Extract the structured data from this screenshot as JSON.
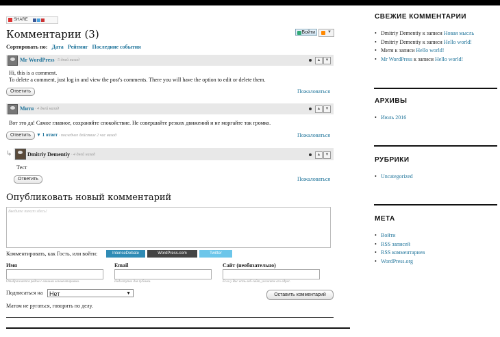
{
  "share_bar": {
    "label": "SHARE"
  },
  "comments": {
    "title": "Комментарии (3)",
    "login_button": "Войти",
    "sort": {
      "label": "Сортировать по:",
      "options": [
        "Дата",
        "Рейтинг",
        "Последние события"
      ]
    },
    "items": [
      {
        "author": "Mr WordPress",
        "meta": "· 5 дней назад",
        "text": [
          "Hi, this is a comment.",
          "To delete a comment, just log in and view the post's comments. There you will have the option to edit or delete them."
        ],
        "reply": "Ответить",
        "report": "Пожаловаться"
      },
      {
        "author": "Митя",
        "meta": "· 4 дней назад",
        "text": [
          "Вот это да! Самое главное, сохраняйте спокойствие. Не совершайте резких движений и не моргайте так громко."
        ],
        "reply": "Ответить",
        "thread_count": "▼ 1 ответ",
        "thread_last": "· последнее действие 2 час назад",
        "report": "Пожаловаться"
      },
      {
        "author": "Dmitriy Dementiy",
        "meta": "· 4 дней назад",
        "text": [
          "Тест"
        ],
        "reply": "Ответить",
        "report": "Пожаловаться"
      }
    ]
  },
  "new_comment": {
    "title": "Опубликовать новый комментарий",
    "placeholder": "Введите текст здесь!",
    "login_prompt": "Комментировать, как Гость, или войти:",
    "services": [
      "IntenseDebate",
      "WordPress.com",
      "Twitter"
    ],
    "fields": [
      {
        "label": "Имя",
        "hint": "Отображается рядом с вашими комментариями."
      },
      {
        "label": "Email",
        "hint": "Недоступно для публики."
      },
      {
        "label": "Сайт (необязательно)",
        "hint": "Если у Вас есть веб-сайт, укажите его адрес."
      }
    ],
    "subscribe_label": "Подписаться на",
    "subscribe_value": "Нет",
    "submit": "Оставить комментарий",
    "rules": "Матом не ругаться, говорить по делу."
  },
  "sidebar": {
    "recent_comments": {
      "title": "СВЕЖИЕ КОММЕНТАРИИ",
      "items": [
        {
          "author": "Dmitriy Dementiy",
          "sep": " к записи ",
          "post": "Новая мысль"
        },
        {
          "author": "Dmitriy Dementiy",
          "sep": " к записи ",
          "post": "Hello world!"
        },
        {
          "author": "Митя",
          "sep": " к записи ",
          "post": "Hello world!"
        },
        {
          "author": "Mr WordPress",
          "sep": " к записи ",
          "post": "Hello world!"
        }
      ]
    },
    "archives": {
      "title": "АРХИВЫ",
      "items": [
        "Июль 2016"
      ]
    },
    "categories": {
      "title": "РУБРИКИ",
      "items": [
        "Uncategorized"
      ]
    },
    "meta": {
      "title": "МЕТА",
      "items": [
        "Войти",
        "RSS записей",
        "RSS комментариев",
        "WordPress.org"
      ]
    }
  },
  "colors": {
    "link": "#21759b",
    "comment_bar": "#e8e8e8"
  }
}
